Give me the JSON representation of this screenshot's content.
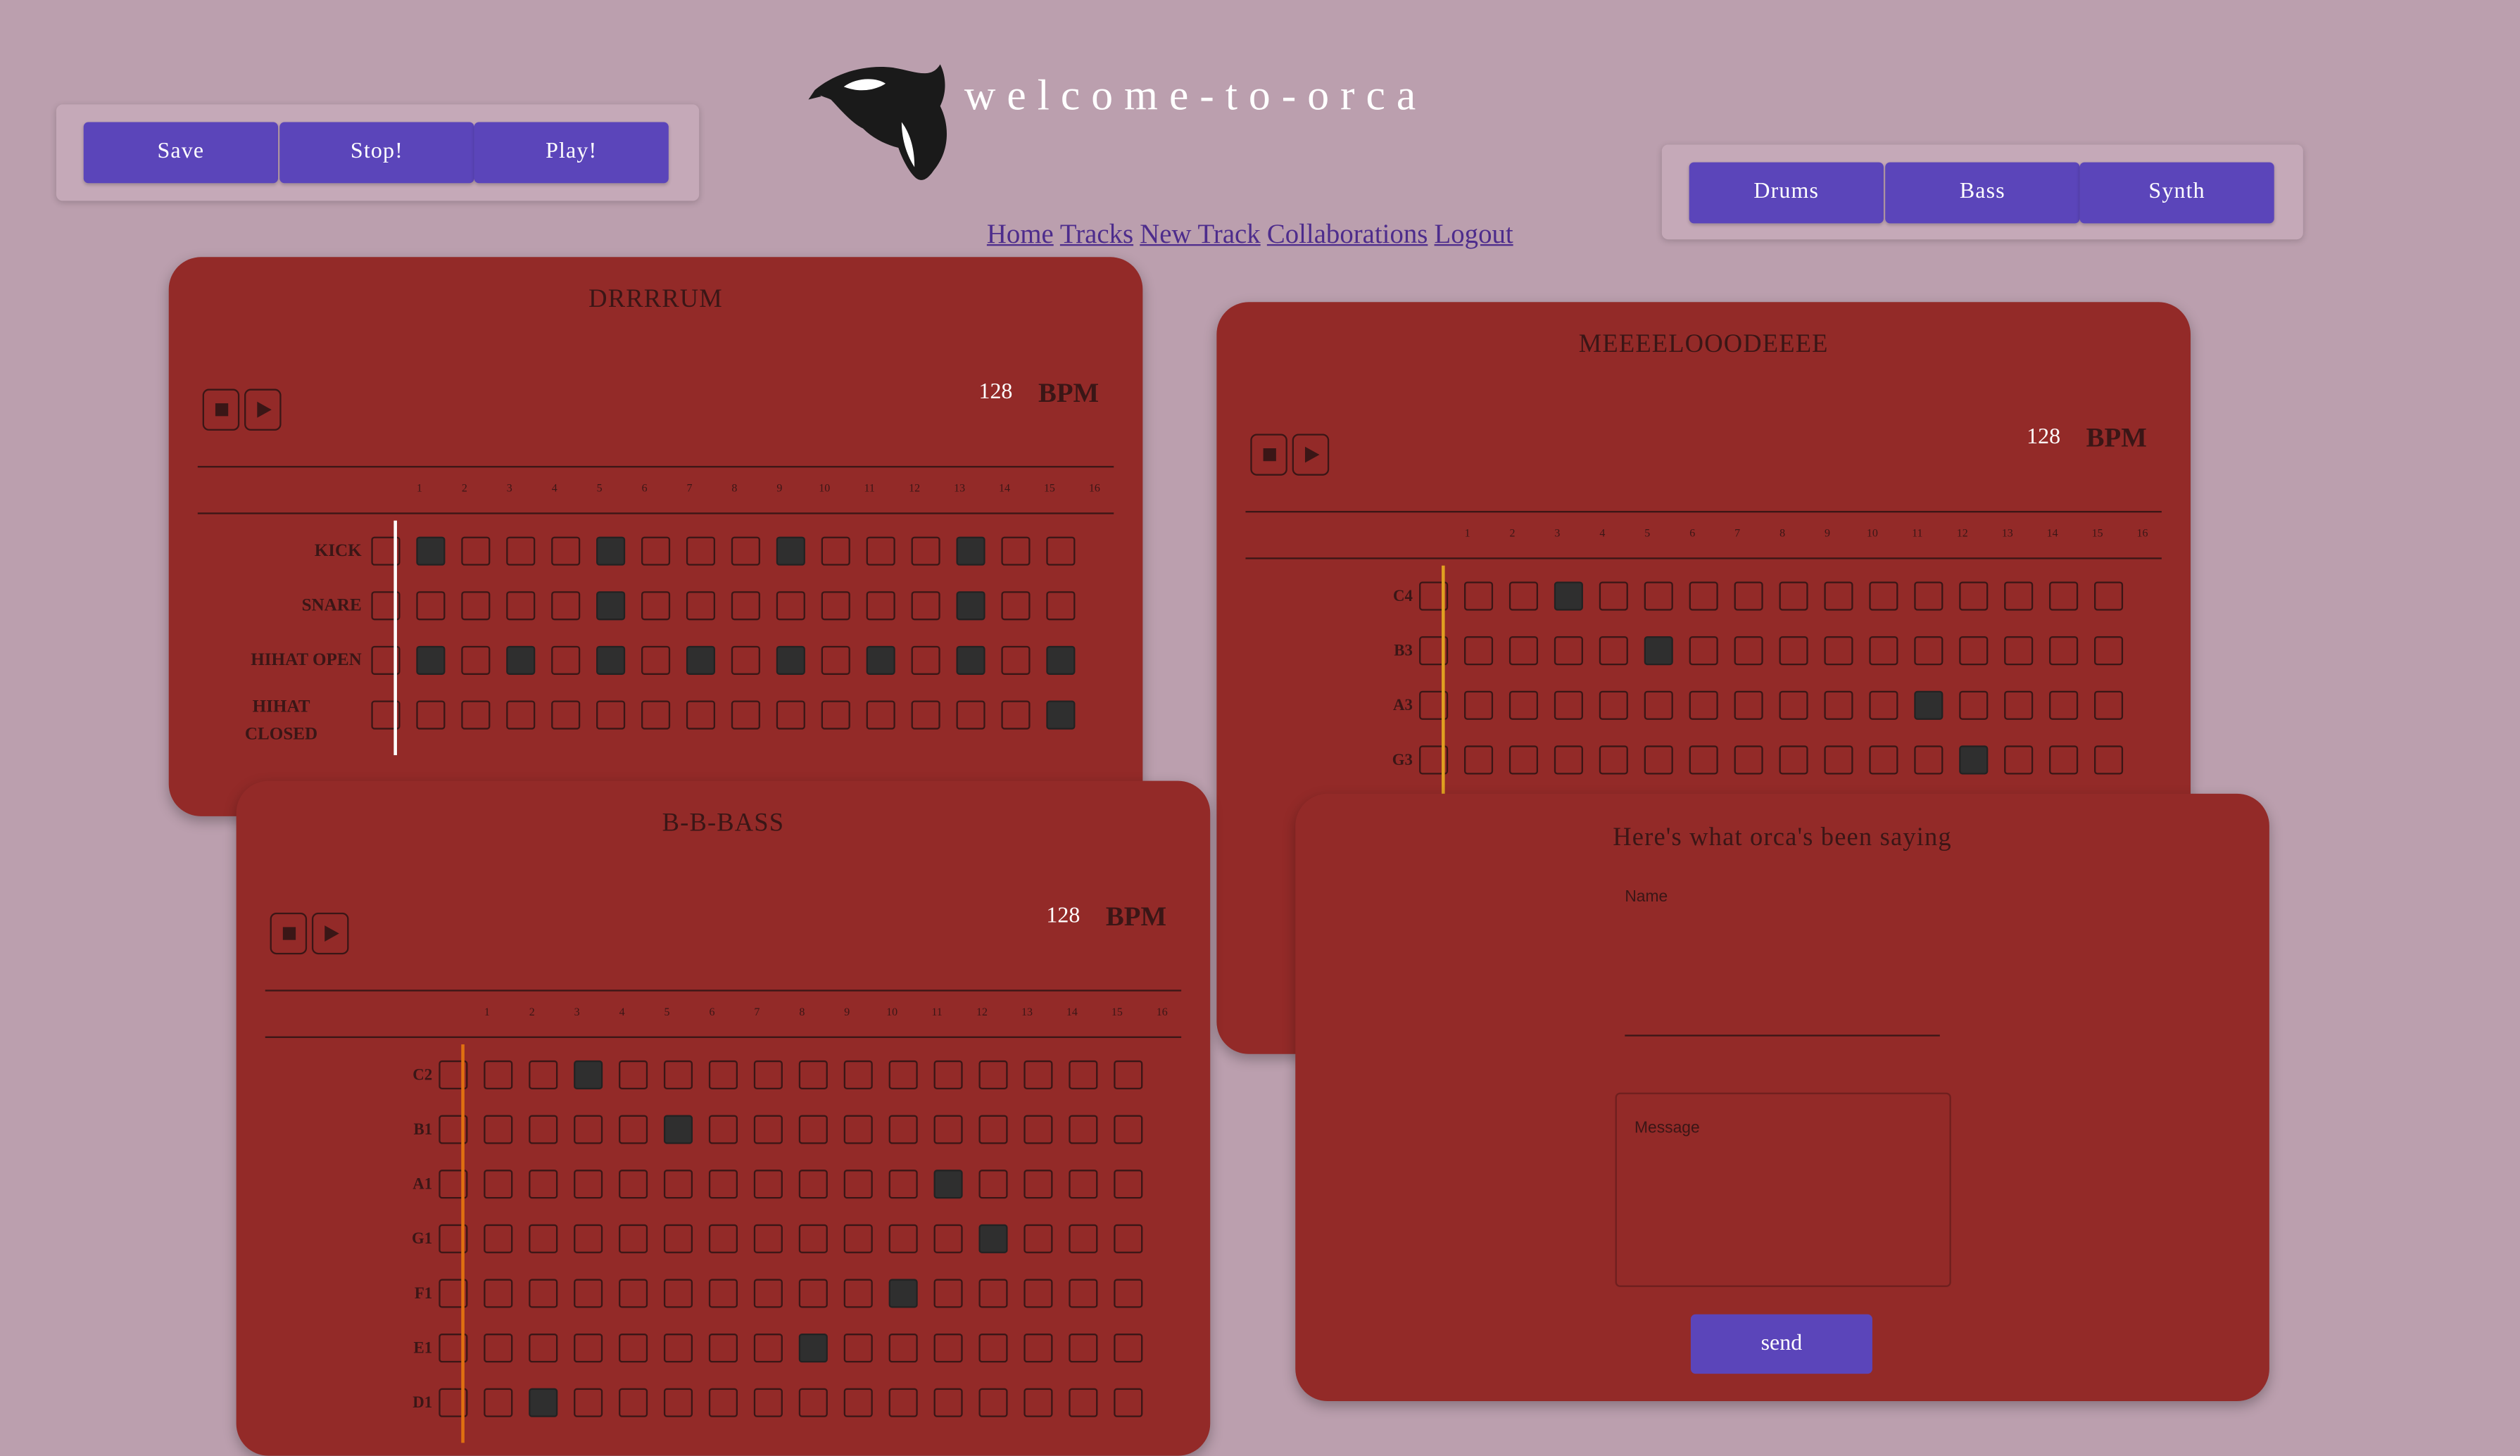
{
  "header": {
    "brand": "welcome-to-orca",
    "logo_icon": "orca-logo-icon",
    "left_buttons": [
      "Save",
      "Stop!",
      "Play!"
    ],
    "right_buttons": [
      "Drums",
      "Bass",
      "Synth"
    ],
    "nav_links": [
      "Home",
      "Tracks",
      "New Track",
      "Collaborations",
      "Logout"
    ]
  },
  "colors": {
    "background": "#bb9fae",
    "panel": "#932a28",
    "button": "#5b45ba",
    "cell_on": "#2f2f2f",
    "playhead_drums": "#ffffff",
    "playhead_synth": "#e0a020",
    "playhead_bass": "#e07010"
  },
  "step_numbers": [
    "1",
    "2",
    "3",
    "4",
    "5",
    "6",
    "7",
    "8",
    "9",
    "10",
    "11",
    "12",
    "13",
    "14",
    "15",
    "16"
  ],
  "panels": {
    "drums": {
      "title": "DRRRRUM",
      "bpm": "128",
      "bpm_label": "BPM",
      "playhead_step": 1,
      "rows": [
        {
          "label": "KICK",
          "on": [
            2,
            6,
            10,
            14
          ]
        },
        {
          "label": "SNARE",
          "on": [
            6,
            14
          ]
        },
        {
          "label": "HIHAT OPEN",
          "on": [
            2,
            4,
            6,
            8,
            10,
            12,
            14,
            16
          ]
        },
        {
          "label": "HIHAT CLOSED",
          "on": [
            16
          ]
        }
      ]
    },
    "synth": {
      "title": "MEEEELOOODEEEE",
      "bpm": "128",
      "bpm_label": "BPM",
      "playhead_step": 1,
      "rows": [
        {
          "label": "C4",
          "on": [
            4
          ]
        },
        {
          "label": "B3",
          "on": [
            6
          ]
        },
        {
          "label": "A3",
          "on": [
            12
          ]
        },
        {
          "label": "G3",
          "on": [
            13
          ]
        }
      ]
    },
    "bass": {
      "title": "B-B-BASS",
      "bpm": "128",
      "bpm_label": "BPM",
      "playhead_step": 1,
      "rows": [
        {
          "label": "C2",
          "on": [
            4
          ]
        },
        {
          "label": "B1",
          "on": [
            6
          ]
        },
        {
          "label": "A1",
          "on": [
            12
          ]
        },
        {
          "label": "G1",
          "on": [
            13
          ]
        },
        {
          "label": "F1",
          "on": [
            11
          ]
        },
        {
          "label": "E1",
          "on": [
            9
          ]
        },
        {
          "label": "D1",
          "on": [
            3
          ]
        }
      ]
    },
    "chat": {
      "title": "Here's what orca's been saying",
      "name_label": "Name",
      "message_label": "Message",
      "send_label": "send"
    }
  }
}
